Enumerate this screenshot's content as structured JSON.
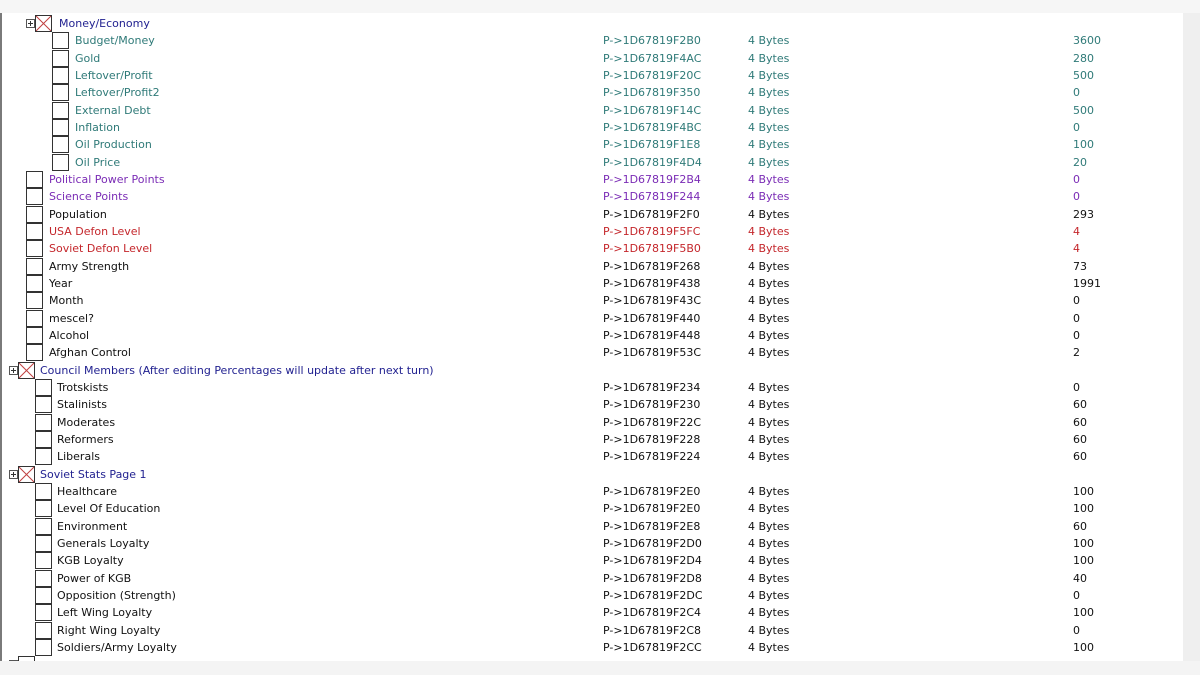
{
  "colors": {
    "group": "#1f1f8f",
    "teal": "#2f7a78",
    "purple": "#7a2bb5",
    "black": "#111111",
    "red": "#c4262b"
  },
  "rows": [
    {
      "kind": "group",
      "level": 1,
      "color": "group",
      "description": "Money/Economy"
    },
    {
      "kind": "item",
      "level": 2,
      "color": "teal",
      "description": "Budget/Money",
      "address": "P->1D67819F2B0",
      "type": "4 Bytes",
      "value": "3600"
    },
    {
      "kind": "item",
      "level": 2,
      "color": "teal",
      "description": "Gold",
      "address": "P->1D67819F4AC",
      "type": "4 Bytes",
      "value": "280"
    },
    {
      "kind": "item",
      "level": 2,
      "color": "teal",
      "description": "Leftover/Profit",
      "address": "P->1D67819F20C",
      "type": "4 Bytes",
      "value": "500"
    },
    {
      "kind": "item",
      "level": 2,
      "color": "teal",
      "description": "Leftover/Profit2",
      "address": "P->1D67819F350",
      "type": "4 Bytes",
      "value": "0"
    },
    {
      "kind": "item",
      "level": 2,
      "color": "teal",
      "description": "External Debt",
      "address": "P->1D67819F14C",
      "type": "4 Bytes",
      "value": "500"
    },
    {
      "kind": "item",
      "level": 2,
      "color": "teal",
      "description": "Inflation",
      "address": "P->1D67819F4BC",
      "type": "4 Bytes",
      "value": "0"
    },
    {
      "kind": "item",
      "level": 2,
      "color": "teal",
      "description": "Oil Production",
      "address": "P->1D67819F1E8",
      "type": "4 Bytes",
      "value": "100"
    },
    {
      "kind": "item",
      "level": 2,
      "color": "teal",
      "description": "Oil Price",
      "address": "P->1D67819F4D4",
      "type": "4 Bytes",
      "value": "20"
    },
    {
      "kind": "item",
      "level": 1,
      "color": "purple",
      "description": "Political Power Points",
      "address": "P->1D67819F2B4",
      "type": "4 Bytes",
      "value": "0"
    },
    {
      "kind": "item",
      "level": 1,
      "color": "purple",
      "description": "Science Points",
      "address": "P->1D67819F244",
      "type": "4 Bytes",
      "value": "0"
    },
    {
      "kind": "item",
      "level": 1,
      "color": "black",
      "description": "Population",
      "address": "P->1D67819F2F0",
      "type": "4 Bytes",
      "value": "293"
    },
    {
      "kind": "item",
      "level": 1,
      "color": "red",
      "description": "USA Defon Level",
      "address": "P->1D67819F5FC",
      "type": "4 Bytes",
      "value": "4"
    },
    {
      "kind": "item",
      "level": 1,
      "color": "red",
      "description": "Soviet Defon Level",
      "address": "P->1D67819F5B0",
      "type": "4 Bytes",
      "value": "4"
    },
    {
      "kind": "item",
      "level": 1,
      "color": "black",
      "description": "Army Strength",
      "address": "P->1D67819F268",
      "type": "4 Bytes",
      "value": "73"
    },
    {
      "kind": "item",
      "level": 1,
      "color": "black",
      "description": "Year",
      "address": "P->1D67819F438",
      "type": "4 Bytes",
      "value": "1991"
    },
    {
      "kind": "item",
      "level": 1,
      "color": "black",
      "description": "Month",
      "address": "P->1D67819F43C",
      "type": "4 Bytes",
      "value": "0"
    },
    {
      "kind": "item",
      "level": 1,
      "color": "black",
      "description": "mescel?",
      "address": "P->1D67819F440",
      "type": "4 Bytes",
      "value": "0"
    },
    {
      "kind": "item",
      "level": 1,
      "color": "black",
      "description": "Alcohol",
      "address": "P->1D67819F448",
      "type": "4 Bytes",
      "value": "0"
    },
    {
      "kind": "item",
      "level": 1,
      "color": "black",
      "description": "Afghan Control",
      "address": "P->1D67819F53C",
      "type": "4 Bytes",
      "value": "2"
    },
    {
      "kind": "group",
      "level": 0,
      "color": "group",
      "description": "Council Members (After editing Percentages will update after next turn)"
    },
    {
      "kind": "item",
      "level": 1.5,
      "color": "black",
      "description": "Trotskists",
      "address": "P->1D67819F234",
      "type": "4 Bytes",
      "value": "0"
    },
    {
      "kind": "item",
      "level": 1.5,
      "color": "black",
      "description": "Stalinists",
      "address": "P->1D67819F230",
      "type": "4 Bytes",
      "value": "60"
    },
    {
      "kind": "item",
      "level": 1.5,
      "color": "black",
      "description": "Moderates",
      "address": "P->1D67819F22C",
      "type": "4 Bytes",
      "value": "60"
    },
    {
      "kind": "item",
      "level": 1.5,
      "color": "black",
      "description": "Reformers",
      "address": "P->1D67819F228",
      "type": "4 Bytes",
      "value": "60"
    },
    {
      "kind": "item",
      "level": 1.5,
      "color": "black",
      "description": "Liberals",
      "address": "P->1D67819F224",
      "type": "4 Bytes",
      "value": "60"
    },
    {
      "kind": "group",
      "level": 0,
      "color": "group",
      "description": "Soviet Stats Page 1"
    },
    {
      "kind": "item",
      "level": 1.5,
      "color": "black",
      "description": "Healthcare",
      "address": "P->1D67819F2E0",
      "type": "4 Bytes",
      "value": "100"
    },
    {
      "kind": "item",
      "level": 1.5,
      "color": "black",
      "description": "Level Of Education",
      "address": "P->1D67819F2E0",
      "type": "4 Bytes",
      "value": "100"
    },
    {
      "kind": "item",
      "level": 1.5,
      "color": "black",
      "description": "Environment",
      "address": "P->1D67819F2E8",
      "type": "4 Bytes",
      "value": "60"
    },
    {
      "kind": "item",
      "level": 1.5,
      "color": "black",
      "description": "Generals Loyalty",
      "address": "P->1D67819F2D0",
      "type": "4 Bytes",
      "value": "100"
    },
    {
      "kind": "item",
      "level": 1.5,
      "color": "black",
      "description": "KGB Loyalty",
      "address": "P->1D67819F2D4",
      "type": "4 Bytes",
      "value": "100"
    },
    {
      "kind": "item",
      "level": 1.5,
      "color": "black",
      "description": "Power of KGB",
      "address": "P->1D67819F2D8",
      "type": "4 Bytes",
      "value": "40"
    },
    {
      "kind": "item",
      "level": 1.5,
      "color": "black",
      "description": "Opposition (Strength)",
      "address": "P->1D67819F2DC",
      "type": "4 Bytes",
      "value": "0"
    },
    {
      "kind": "item",
      "level": 1.5,
      "color": "black",
      "description": "Left Wing Loyalty",
      "address": "P->1D67819F2C4",
      "type": "4 Bytes",
      "value": "100"
    },
    {
      "kind": "item",
      "level": 1.5,
      "color": "black",
      "description": "Right Wing Loyalty",
      "address": "P->1D67819F2C8",
      "type": "4 Bytes",
      "value": "0"
    },
    {
      "kind": "item",
      "level": 1.5,
      "color": "black",
      "description": "Soldiers/Army Loyalty",
      "address": "P->1D67819F2CC",
      "type": "4 Bytes",
      "value": "100"
    }
  ]
}
